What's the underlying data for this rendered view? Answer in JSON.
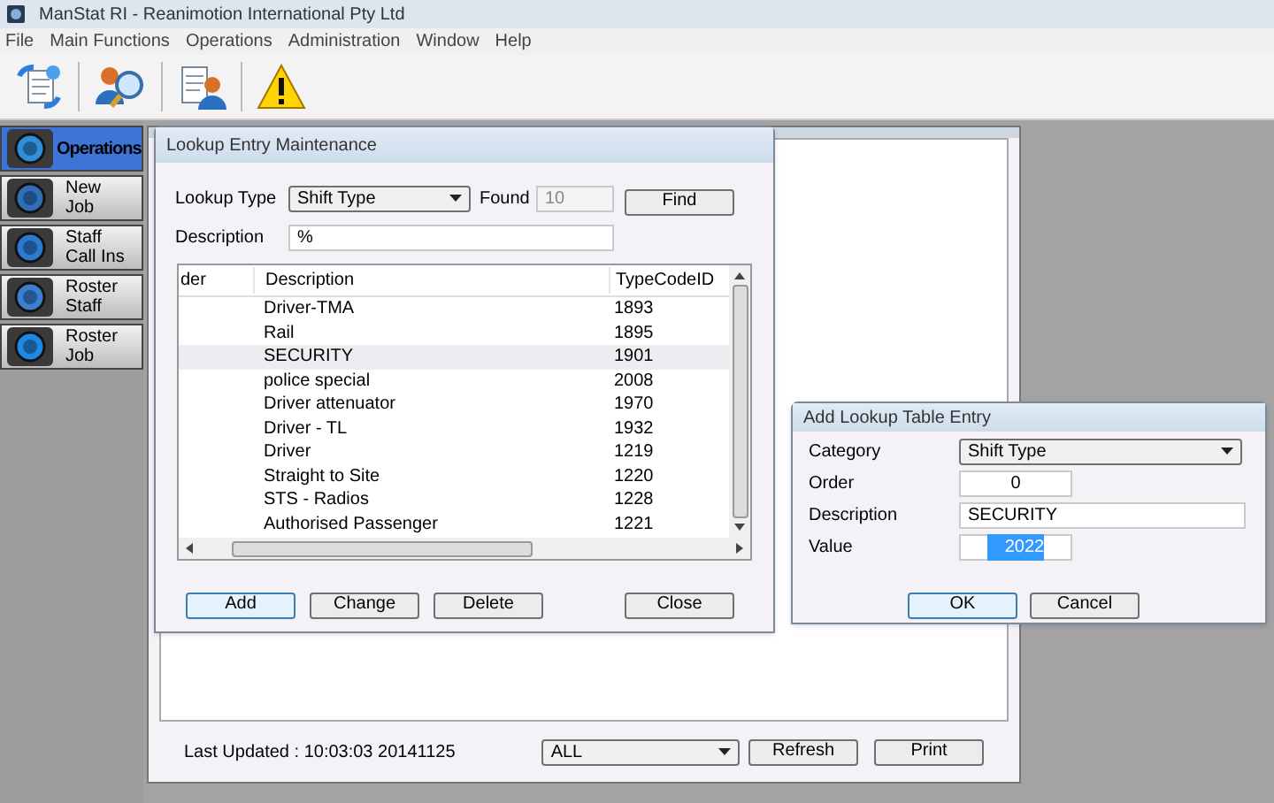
{
  "title_bar": {
    "title": "ManStat RI - Reanimotion International Pty Ltd"
  },
  "menu": [
    "File",
    "Main Functions",
    "Operations",
    "Administration",
    "Window",
    "Help"
  ],
  "sidebar": {
    "items": [
      {
        "label": "Operations",
        "selected": true
      },
      {
        "label": "New Job",
        "selected": false
      },
      {
        "label": "Staff Call Ins",
        "selected": false
      },
      {
        "label": "Roster Staff",
        "selected": false
      },
      {
        "label": "Roster Job",
        "selected": false
      }
    ]
  },
  "lookup_dialog": {
    "title": "Lookup Entry Maintenance",
    "lookup_type_label": "Lookup Type",
    "lookup_type": "Shift Type",
    "found_label": "Found",
    "found": "10",
    "find_button": "Find",
    "description_label": "Description",
    "description": "%",
    "table": {
      "columns": [
        "der",
        "Description",
        "TypeCodeID"
      ],
      "rows": [
        {
          "description": "Driver-TMA",
          "code": "1893",
          "selected": false
        },
        {
          "description": "Rail",
          "code": "1895",
          "selected": false
        },
        {
          "description": "SECURITY",
          "code": "1901",
          "selected": true
        },
        {
          "description": "police special",
          "code": "2008",
          "selected": false
        },
        {
          "description": "Driver attenuator",
          "code": "1970",
          "selected": false
        },
        {
          "description": "Driver - TL",
          "code": "1932",
          "selected": false
        },
        {
          "description": "Driver",
          "code": "1219",
          "selected": false
        },
        {
          "description": "Straight to Site",
          "code": "1220",
          "selected": false
        },
        {
          "description": "STS - Radios",
          "code": "1228",
          "selected": false
        },
        {
          "description": "Authorised Passenger",
          "code": "1221",
          "selected": false
        }
      ]
    },
    "buttons": [
      {
        "label": "Add",
        "focused": true
      },
      {
        "label": "Change",
        "focused": false
      },
      {
        "label": "Delete",
        "focused": false
      },
      {
        "label": "Close",
        "focused": false
      }
    ]
  },
  "add_dialog": {
    "title": "Add Lookup Table Entry",
    "fields": [
      {
        "label": "Category",
        "kind": "select",
        "value": "Shift Type"
      },
      {
        "label": "Order",
        "kind": "short",
        "value": "0"
      },
      {
        "label": "Description",
        "kind": "text",
        "value": "SECURITY"
      },
      {
        "label": "Value",
        "kind": "short",
        "value": "2022",
        "text_selected": true
      }
    ],
    "buttons": [
      {
        "label": "OK",
        "focused": true
      },
      {
        "label": "Cancel",
        "focused": false
      }
    ]
  },
  "status": {
    "last_updated": "Last Updated : 10:03:03 20141125",
    "filter": "ALL",
    "buttons": [
      "Refresh",
      "Print"
    ]
  }
}
